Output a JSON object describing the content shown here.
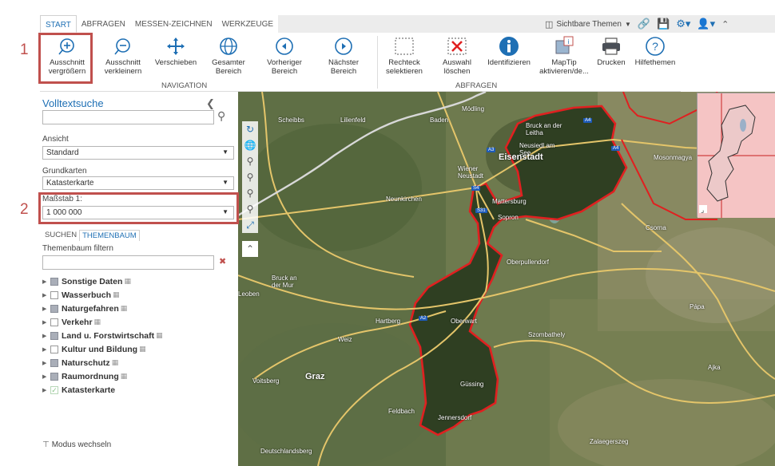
{
  "tabs": [
    "START",
    "ABFRAGEN",
    "MESSEN-ZEICHNEN",
    "WERKZEUGE"
  ],
  "themes_button": "Sichtbare Themen",
  "ribbon": {
    "buttons": [
      {
        "label": "Ausschnitt vergrößern",
        "icon": "zoom-in-icon"
      },
      {
        "label": "Ausschnitt verkleinern",
        "icon": "zoom-out-icon"
      },
      {
        "label": "Verschieben",
        "icon": "pan-icon"
      },
      {
        "label": "Gesamter Bereich",
        "icon": "globe-icon"
      },
      {
        "label": "Vorheriger Bereich",
        "icon": "back-icon"
      },
      {
        "label": "Nächster Bereich",
        "icon": "forward-icon"
      },
      {
        "label": "Rechteck selektieren",
        "icon": "rectangle-select-icon"
      },
      {
        "label": "Auswahl löschen",
        "icon": "delete-selection-icon"
      },
      {
        "label": "Identifizieren",
        "icon": "info-icon"
      },
      {
        "label": "MapTip aktivieren/de...",
        "icon": "maptip-icon"
      },
      {
        "label": "Drucken",
        "icon": "printer-icon"
      },
      {
        "label": "Hilfethemen",
        "icon": "help-icon"
      }
    ],
    "group_navigation": "NAVIGATION",
    "group_abfragen": "ABFRAGEN"
  },
  "callouts": [
    "1",
    "2"
  ],
  "panel": {
    "search_title": "Volltextsuche",
    "ansicht_label": "Ansicht",
    "ansicht_value": "Standard",
    "grundkarten_label": "Grundkarten",
    "grundkarten_value": "Katasterkarte",
    "massstab_label": "Maßstab 1:",
    "massstab_value": "1 000 000",
    "subtabs": [
      "SUCHEN",
      "THEMENBAUM"
    ],
    "filter_label": "Themenbaum filtern",
    "tree": [
      {
        "label": "Sonstige Daten",
        "state": "partial"
      },
      {
        "label": "Wasserbuch",
        "state": "empty"
      },
      {
        "label": "Naturgefahren",
        "state": "partial"
      },
      {
        "label": "Verkehr",
        "state": "empty"
      },
      {
        "label": "Land u. Forstwirtschaft",
        "state": "partial"
      },
      {
        "label": "Kultur und Bildung",
        "state": "empty"
      },
      {
        "label": "Naturschutz",
        "state": "partial"
      },
      {
        "label": "Raumordnung",
        "state": "partial"
      },
      {
        "label": "Katasterkarte",
        "state": "checked"
      }
    ],
    "modus": "Modus wechseln"
  },
  "map": {
    "places": [
      "Scheibbs",
      "Lilienfeld",
      "Baden",
      "Mödling",
      "Bruck an der Leitha",
      "Neusiedl am See",
      "Mosonmagya",
      "Wiener Neustadt",
      "Eisenstadt",
      "Neunkirchen",
      "Mattersburg",
      "Sopron",
      "Csorna",
      "Oberpullendorf",
      "Bruck an der Mur",
      "Leoben",
      "Hartberg",
      "Oberwart",
      "Pápa",
      "Weiz",
      "Szombathely",
      "Ajka",
      "Graz",
      "Voitsberg",
      "Güssing",
      "Feldbach",
      "Jennersdorf",
      "Deutschlandsberg",
      "Zalaegerszeg"
    ],
    "road_shields": [
      "A4",
      "A4",
      "A3",
      "S4",
      "S31",
      "A2"
    ]
  }
}
